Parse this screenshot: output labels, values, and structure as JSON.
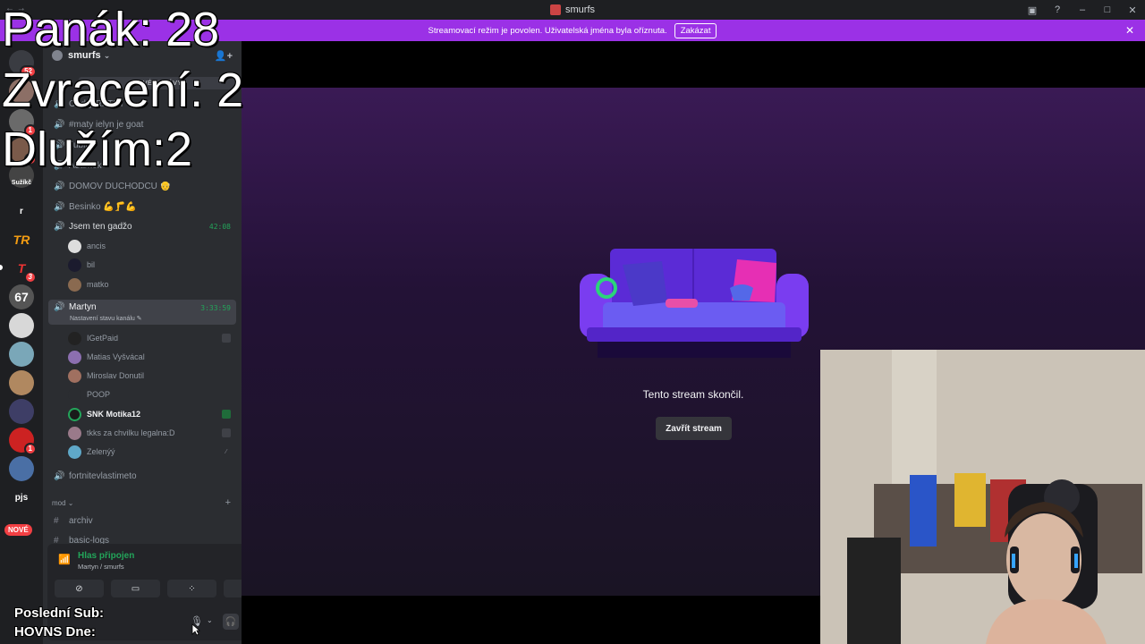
{
  "window": {
    "title": "smurfs",
    "minimize": "–",
    "maximize": "□",
    "close": "✕",
    "inbox": "▣",
    "help": "?",
    "nav_hint": "← →"
  },
  "banner": {
    "text": "Streamovací režim je povolen. Uživatelská jména byla oříznuta.",
    "button": "Zakázat",
    "close": "✕"
  },
  "guilds": {
    "items": [
      {
        "name": "avatar-1",
        "badge": "52"
      },
      {
        "name": "avatar-2",
        "badge": ""
      },
      {
        "name": "avatar-3",
        "badge": "1"
      },
      {
        "name": "avatar-4",
        "badge": "1"
      },
      {
        "name": "avatar-5",
        "badge": ""
      },
      {
        "label": "Sužíkč"
      },
      {
        "label": "r"
      },
      {
        "label": "TR"
      },
      {
        "label": "T",
        "badge": "3"
      },
      {
        "label": "67"
      }
    ],
    "pjs_label": "pjs",
    "nove_label": "NOVÉ"
  },
  "server": {
    "name": "smurfs",
    "name_chevron": "⌄",
    "invite_icon": "👤+",
    "tooltip": "NOVÉ ZPRÁVY"
  },
  "channels": [
    {
      "name": "Ondry RATIM"
    },
    {
      "name": "#maty ielyn je goat"
    },
    {
      "name": "Jublí"
    },
    {
      "name": "Adamek"
    },
    {
      "name": "DOMOV DUCHODCU 👴"
    },
    {
      "name": "Besinko 💪🦵💪"
    },
    {
      "name": "Jsem ten gadžo",
      "time": "42:08"
    }
  ],
  "users_group1": [
    {
      "name": "ancis"
    },
    {
      "name": "bil"
    },
    {
      "name": "matko"
    }
  ],
  "active_channel": {
    "name": "Martyn",
    "time": "3:33:59",
    "sub": "Nastavení stavu kanálu ✎"
  },
  "users_group2": [
    {
      "name": "IGetPaid"
    },
    {
      "name": "Matias Vyšvácal"
    },
    {
      "name": "Miroslav Donutil"
    },
    {
      "name": "POOP"
    },
    {
      "name": "SNK Motika12"
    },
    {
      "name": "tkks za chvilku legalna:D"
    },
    {
      "name": "Zelenýý"
    }
  ],
  "channels_after": [
    {
      "name": "fortnitevlastimeto"
    }
  ],
  "category": {
    "name": "mod ⌄",
    "plus": "+"
  },
  "text_channels": [
    {
      "name": "archiv"
    },
    {
      "name": "basic-logs"
    }
  ],
  "voice_panel": {
    "status": "Hlas připojen",
    "location": "Martyn / smurfs",
    "signal_icon": "📶",
    "activity_icon": "𝄃",
    "disconnect_icon": "☎",
    "buttons": [
      "⊘",
      "▭",
      "⁘",
      "✦"
    ],
    "mic_icon": "🎙",
    "headset_icon": "🎧",
    "gear_icon": "⚙",
    "chevron": "⌄"
  },
  "stream": {
    "ended_text": "Tento stream skončil.",
    "close_button": "Zavřít stream"
  },
  "overlay": {
    "line1": "Panák: 28",
    "line2": "Zvracení: 2",
    "line3": "Dlužím:2",
    "line4": "Poslední Sub:",
    "line5": "HOVNS Dne:"
  },
  "colors": {
    "accent": "#9b31e6",
    "online": "#23a55a",
    "badge": "#f23f43"
  }
}
